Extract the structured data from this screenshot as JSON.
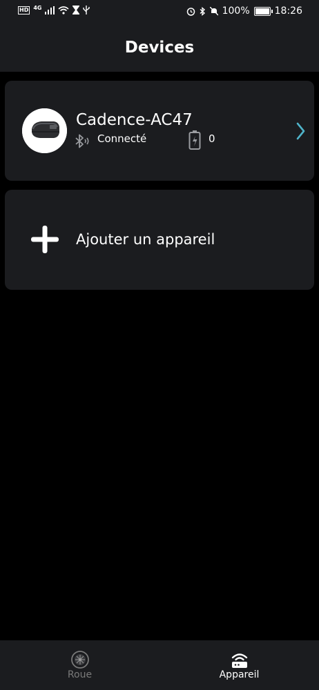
{
  "status_bar": {
    "left_badges": [
      "HD",
      "4G"
    ],
    "battery_percent": "100%",
    "battery_level": 1.0,
    "time": "18:26",
    "icons": [
      "hd-icon",
      "signal-icon",
      "wifi-icon",
      "hourglass-icon",
      "usb-icon",
      "alarm-icon",
      "bluetooth-icon",
      "mute-icon",
      "battery-icon"
    ]
  },
  "header": {
    "title": "Devices"
  },
  "device": {
    "name": "Cadence-AC47",
    "status": "Connecté",
    "battery_value": "0",
    "icons": {
      "avatar": "cadence-sensor-image",
      "connection": "bluetooth-icon",
      "battery": "battery-charging-icon",
      "open": "chevron-right-icon"
    },
    "chevron_color": "#4fb3c9"
  },
  "add_device": {
    "label": "Ajouter un appareil",
    "icon": "plus-icon"
  },
  "bottom_nav": {
    "items": [
      {
        "label": "Roue",
        "icon": "wheel-icon",
        "active": false
      },
      {
        "label": "Appareil",
        "icon": "device-icon",
        "active": true
      }
    ]
  },
  "colors": {
    "background": "#000000",
    "surface": "#1b1c1f",
    "text": "#ffffff",
    "inactive": "#7a7a7a",
    "accent": "#4fb3c9"
  }
}
